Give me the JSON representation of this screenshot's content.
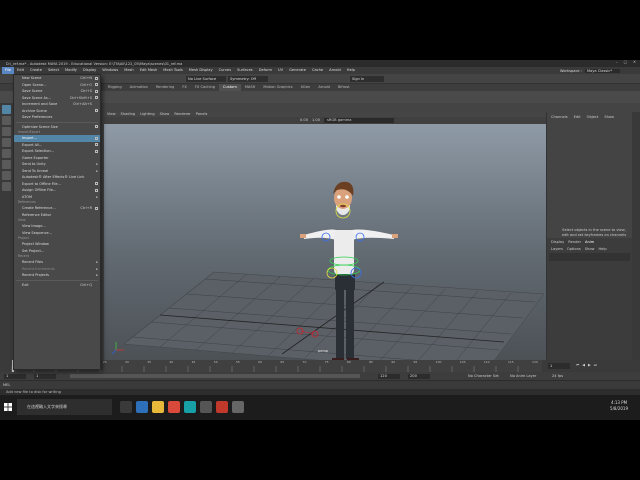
{
  "window": {
    "title": "D:\\_ref.ma* - Autodesk MAYA 2019 - Educational Version: E:\\TN\\Ali\\122_05\\Maya\\scenes\\01_ref.ma"
  },
  "menubar": {
    "items": [
      "File",
      "Edit",
      "Create",
      "Select",
      "Modify",
      "Display",
      "Windows",
      "Mesh",
      "Edit Mesh",
      "Mesh Tools",
      "Mesh Display",
      "Curves",
      "Surfaces",
      "Deform",
      "UV",
      "Generate",
      "Cache",
      "Arnold",
      "Help"
    ],
    "workspace_label": "Workspace :",
    "workspace_value": "Maya Classic*"
  },
  "statusline": {
    "live_surface": "No Live Surface",
    "symmetry": "Symmetry: Off",
    "sign_in": "Sign In"
  },
  "shelf": {
    "tabs": [
      "Rigging",
      "Animation",
      "Rendering",
      "FX",
      "FX Caching",
      "Custom",
      "MASH",
      "Motion Graphics",
      "XGen",
      "Arnold",
      "Bifrost"
    ],
    "active_tab": "Custom"
  },
  "viewport": {
    "menu": [
      "View",
      "Shading",
      "Lighting",
      "Show",
      "Renderer",
      "Panels"
    ],
    "camera_field": "sRGB gamma",
    "num_a": "0.00",
    "num_b": "1.00",
    "camera_label": "persp"
  },
  "channel_box": {
    "tabs": [
      "Channels",
      "Edit",
      "Object",
      "Show"
    ],
    "message": "Select objects in the scene to view, edit and set keyframes on channels (attributes)"
  },
  "layer_editor": {
    "tabs": [
      "Display",
      "Render",
      "Anim"
    ],
    "active_tab": "Anim",
    "sub": [
      "Layers",
      "Options",
      "Show",
      "Help"
    ]
  },
  "timeline": {
    "ticks": [
      "5",
      "10",
      "15",
      "20",
      "25",
      "30",
      "35",
      "40",
      "45",
      "50",
      "55",
      "60",
      "65",
      "70",
      "75",
      "80",
      "85",
      "90",
      "95",
      "100",
      "105",
      "110",
      "115",
      "120"
    ],
    "current_frame": "1"
  },
  "range": {
    "start": "1",
    "inner_start": "1",
    "inner_end": "120",
    "end": "120",
    "outer_end": "200",
    "character_set": "No Character Set",
    "anim_layer": "No Anim Layer",
    "fps": "24 fps"
  },
  "cmdline": {
    "label": "MEL"
  },
  "helpline": {
    "text": "Add new file to disk for writing"
  },
  "file_menu": {
    "sections": [
      {
        "header": "",
        "items": [
          {
            "label": "New Scene",
            "shortcut": "Ctrl+N",
            "option": true
          },
          {
            "label": "Open Scene...",
            "shortcut": "Ctrl+O",
            "option": true
          },
          {
            "label": "Save Scene",
            "shortcut": "Ctrl+S",
            "option": true
          },
          {
            "label": "Save Scene As...",
            "shortcut": "Ctrl+Shift+S",
            "option": true
          },
          {
            "label": "Increment and Save",
            "shortcut": "Ctrl+Alt+S",
            "option": false
          },
          {
            "label": "Archive Scene",
            "shortcut": "",
            "option": true
          },
          {
            "label": "Save Preferences",
            "shortcut": "",
            "option": false
          }
        ]
      },
      {
        "header": "",
        "items": [
          {
            "label": "Optimize Scene Size",
            "shortcut": "",
            "option": true
          }
        ]
      },
      {
        "header": "Import/Export",
        "items": [
          {
            "label": "Import...",
            "shortcut": "",
            "option": true,
            "highlighted": true
          },
          {
            "label": "Export All...",
            "shortcut": "",
            "option": true
          },
          {
            "label": "Export Selection...",
            "shortcut": "",
            "option": true
          },
          {
            "label": "Game Exporter",
            "shortcut": "",
            "option": false
          },
          {
            "label": "Send to Unity",
            "shortcut": "",
            "submenu": true
          },
          {
            "label": "Send To Unreal",
            "shortcut": "",
            "submenu": true
          },
          {
            "label": "Autodesk® After Effects® Live Link",
            "shortcut": "",
            "option": false
          },
          {
            "label": "Export to Offline File...",
            "shortcut": "",
            "option": true
          },
          {
            "label": "Assign Offline File...",
            "shortcut": "",
            "option": true
          },
          {
            "label": "ATOM",
            "shortcut": "",
            "submenu": true
          }
        ]
      },
      {
        "header": "References",
        "items": [
          {
            "label": "Create Reference...",
            "shortcut": "Ctrl+R",
            "option": true
          },
          {
            "label": "Reference Editor",
            "shortcut": "",
            "option": false
          }
        ]
      },
      {
        "header": "View",
        "items": [
          {
            "label": "View Image...",
            "shortcut": "",
            "option": false
          },
          {
            "label": "View Sequence...",
            "shortcut": "",
            "option": false
          }
        ]
      },
      {
        "header": "Project",
        "items": [
          {
            "label": "Project Window",
            "shortcut": "",
            "option": false
          },
          {
            "label": "Set Project...",
            "shortcut": "",
            "option": false
          }
        ]
      },
      {
        "header": "Recent",
        "items": [
          {
            "label": "Recent Files",
            "shortcut": "",
            "submenu": true
          },
          {
            "label": "Recent Increments",
            "shortcut": "",
            "submenu": true,
            "disabled": true
          },
          {
            "label": "Recent Projects",
            "shortcut": "",
            "submenu": true
          }
        ]
      },
      {
        "header": "",
        "items": [
          {
            "label": "Exit",
            "shortcut": "Ctrl+Q",
            "option": false
          }
        ]
      }
    ]
  },
  "taskbar": {
    "search_placeholder": "在這裡輸入文字來搜尋",
    "time": "4:13 PM",
    "date": "5/8/2019"
  },
  "colors": {
    "accent": "#5285a6",
    "menu_bg": "#494949",
    "viewport_top": "#8e9aa6"
  }
}
